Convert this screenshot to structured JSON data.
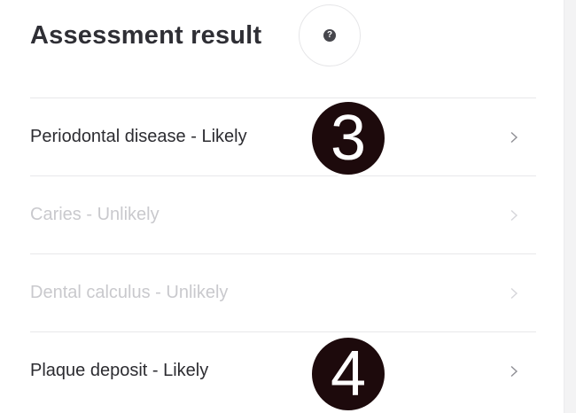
{
  "header": {
    "title": "Assessment result",
    "help_icon": "question-circle-icon",
    "help_glyph": "?"
  },
  "results": [
    {
      "label": "Periodontal disease - Likely",
      "status": "likely",
      "icon": "chevron-right-icon"
    },
    {
      "label": "Caries - Unlikely",
      "status": "unlikely",
      "icon": "chevron-right-icon"
    },
    {
      "label": "Dental calculus - Unlikely",
      "status": "unlikely",
      "icon": "chevron-right-icon"
    },
    {
      "label": "Plaque deposit - Likely",
      "status": "likely",
      "icon": "chevron-right-icon"
    }
  ],
  "annotations": [
    {
      "number": "3"
    },
    {
      "number": "4"
    }
  ],
  "colors": {
    "likely_text": "#2c2c31",
    "unlikely_text": "#c9c9cd",
    "marker_fill": "#1d0a0c",
    "divider": "#e8e8ea"
  }
}
